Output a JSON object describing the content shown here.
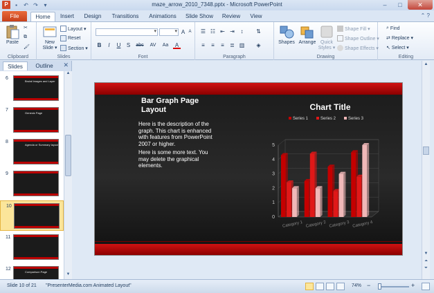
{
  "window": {
    "title": "maze_arrow_2010_7348.pptx - Microsoft PowerPoint",
    "app_icon": "P",
    "controls": [
      "–",
      "□",
      "✕"
    ]
  },
  "tabs": {
    "file": "File",
    "items": [
      "Home",
      "Insert",
      "Design",
      "Transitions",
      "Animations",
      "Slide Show",
      "Review",
      "View"
    ],
    "active": "Home"
  },
  "ribbon": {
    "clipboard": {
      "label": "Clipboard",
      "paste": "Paste"
    },
    "slides": {
      "label": "Slides",
      "new_slide_1": "New",
      "new_slide_2": "Slide ▾",
      "layout": "Layout ▾",
      "reset": "Reset",
      "section": "Section ▾"
    },
    "font": {
      "label": "Font",
      "bold": "B",
      "italic": "I",
      "underline": "U",
      "strike": "S",
      "abc": "abc",
      "grow": "A",
      "shrink": "A",
      "clear": "A",
      "av": "AV",
      "aa": "Aa",
      "color": "A"
    },
    "paragraph": {
      "label": "Paragraph"
    },
    "drawing": {
      "label": "Drawing",
      "shapes": "Shapes",
      "arrange": "Arrange",
      "quick_1": "Quick",
      "quick_2": "Styles ▾",
      "shape_fill": "Shape Fill ▾",
      "shape_outline": "Shape Outline ▾",
      "shape_effects": "Shape Effects ▾"
    },
    "editing": {
      "label": "Editing",
      "find": "Find",
      "replace": "Replace ▾",
      "select": "Select ▾"
    }
  },
  "panel": {
    "tabs": [
      "Slides",
      "Outline"
    ],
    "close": "✕",
    "thumbnails": [
      {
        "num": "6",
        "title": "Brutal Images and Layer"
      },
      {
        "num": "7",
        "title": "Genesis Page"
      },
      {
        "num": "8",
        "title": "Agenda or Summary layout"
      },
      {
        "num": "9",
        "title": ""
      },
      {
        "num": "10",
        "title": "",
        "selected": true
      },
      {
        "num": "11",
        "title": ""
      },
      {
        "num": "12",
        "title": "Comparison Page"
      }
    ]
  },
  "slide": {
    "title": "Bar Graph Page Layout",
    "desc_1": "Here is the description of the graph.  This chart is enhanced with features from PowerPoint 2007 or higher.",
    "desc_2": "Here is some more text. You may delete the graphical elements."
  },
  "chart_data": {
    "type": "bar",
    "title": "Chart Title",
    "categories": [
      "Category 1",
      "Category 2",
      "Category 3",
      "Category 4"
    ],
    "series": [
      {
        "name": "Series 1",
        "values": [
          4.3,
          2.5,
          3.5,
          4.5
        ],
        "color": "#c40000"
      },
      {
        "name": "Series 2",
        "values": [
          2.4,
          4.4,
          1.8,
          2.8
        ],
        "color": "#e01818"
      },
      {
        "name": "Series 3",
        "values": [
          2.0,
          2.0,
          3.0,
          5.0
        ],
        "color": "#f0b8b8"
      }
    ],
    "y_ticks": [
      "0",
      "1",
      "2",
      "3",
      "4",
      "5"
    ],
    "ylim": [
      0,
      5
    ],
    "grid": true,
    "legend": "top"
  },
  "status": {
    "slide": "Slide 10 of 21",
    "theme": "\"PresenterMedia.com Animated Layout\"",
    "zoom": "74%",
    "zoom_out": "−",
    "zoom_in": "+"
  }
}
